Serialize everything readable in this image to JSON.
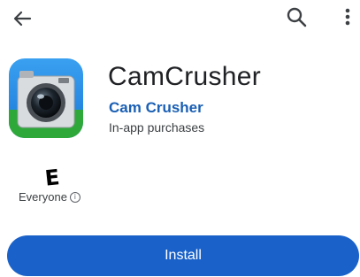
{
  "topbar": {
    "back_icon": "arrow-left-icon",
    "search_icon": "search-icon",
    "more_icon": "more-vert-icon"
  },
  "app": {
    "title": "CamCrusher",
    "developer": "Cam Crusher",
    "in_app_purchases": "In-app purchases",
    "icon": "camera-app-icon"
  },
  "rating": {
    "badge_letter": "E",
    "label": "Everyone",
    "info_icon": "info-icon"
  },
  "actions": {
    "install_label": "Install"
  },
  "colors": {
    "accent": "#1a62c9",
    "developer_link": "#1a5fb4"
  }
}
